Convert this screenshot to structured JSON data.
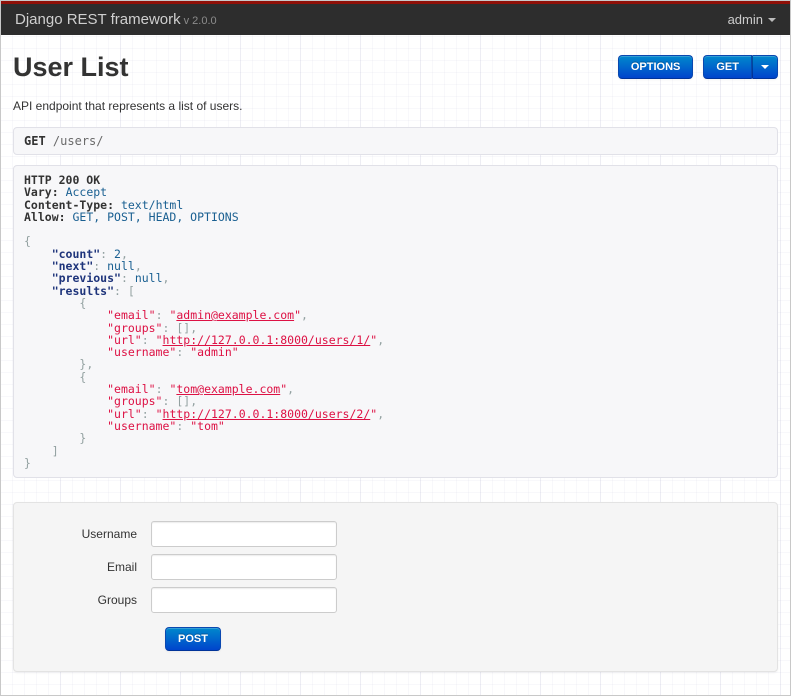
{
  "navbar": {
    "brand": "Django REST framework",
    "version": "v 2.0.0",
    "user_menu_label": "admin"
  },
  "header": {
    "title": "User List",
    "description": "API endpoint that represents a list of users.",
    "options_button": "OPTIONS",
    "get_button": "GET"
  },
  "request_bar": {
    "method": "GET",
    "path": "/users/"
  },
  "response": {
    "status_line": "HTTP 200 OK",
    "headers": [
      {
        "name": "Vary",
        "value": "Accept"
      },
      {
        "name": "Content-Type",
        "value": "text/html"
      },
      {
        "name": "Allow",
        "value": "GET, POST, HEAD, OPTIONS"
      }
    ],
    "body": {
      "count": 2,
      "next": null,
      "previous": null,
      "results": [
        {
          "email": "admin@example.com",
          "groups": [],
          "url": "http://127.0.0.1:8000/users/1/",
          "username": "admin"
        },
        {
          "email": "tom@example.com",
          "groups": [],
          "url": "http://127.0.0.1:8000/users/2/",
          "username": "tom"
        }
      ]
    }
  },
  "form": {
    "fields": [
      {
        "label": "Username",
        "name": "username",
        "value": ""
      },
      {
        "label": "Email",
        "name": "email",
        "value": ""
      },
      {
        "label": "Groups",
        "name": "groups",
        "value": ""
      }
    ],
    "submit_label": "POST"
  },
  "colors": {
    "accent_strip": "#8f1008",
    "navbar_bg": "#2d2d2d",
    "button_gradient_top": "#0088cc",
    "button_gradient_bottom": "#0044cc",
    "code_string": "#dd1144",
    "code_literal": "#195f91",
    "code_key": "#1e347b",
    "code_punctuation": "#93a1a1",
    "panel_bg": "#f7f7f9",
    "panel_border": "#e1e1e8"
  }
}
